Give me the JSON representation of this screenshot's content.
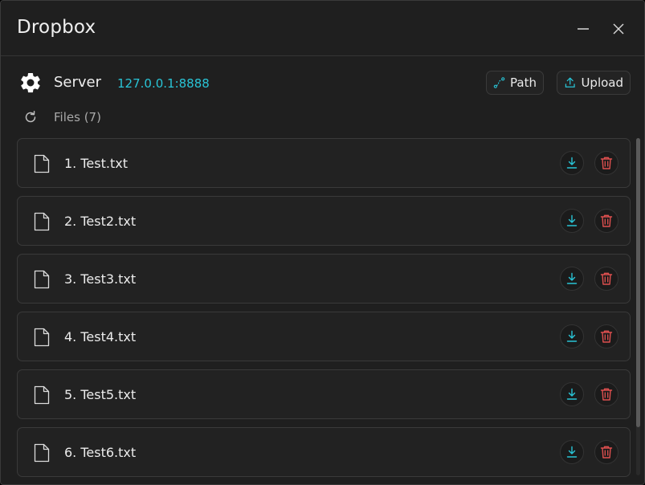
{
  "window": {
    "title": "Dropbox"
  },
  "server": {
    "label": "Server",
    "address": "127.0.0.1:8888"
  },
  "toolbar": {
    "path_label": "Path",
    "upload_label": "Upload"
  },
  "files": {
    "label": "Files",
    "count_text": "(7)",
    "items": [
      {
        "name": "1. Test.txt"
      },
      {
        "name": "2. Test2.txt"
      },
      {
        "name": "3. Test3.txt"
      },
      {
        "name": "4. Test4.txt"
      },
      {
        "name": "5. Test5.txt"
      },
      {
        "name": "6. Test6.txt"
      }
    ]
  },
  "colors": {
    "accent": "#29c4d6",
    "danger": "#e0504f",
    "background": "#1f1f1f",
    "row_background": "#222222",
    "border": "#3a3a3a"
  },
  "icons": {
    "settings": "gear-icon",
    "refresh": "refresh-icon",
    "file": "file-icon",
    "download": "download-icon",
    "delete": "trash-icon",
    "path": "path-icon",
    "upload": "upload-icon",
    "minimize": "minimize-icon",
    "close": "close-icon"
  }
}
